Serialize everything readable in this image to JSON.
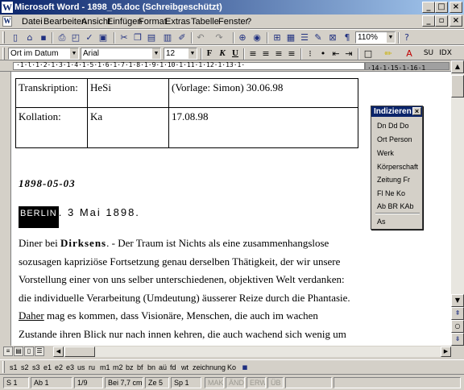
{
  "window": {
    "title": "Microsoft Word - 1898_05.doc (Schreibgeschützt)",
    "app_icon": "W",
    "minimize": "_",
    "maximize": "□",
    "close": "×",
    "doc_minimize": "_",
    "doc_restore": "▫",
    "doc_close": "×"
  },
  "menu": [
    "Datei",
    "Bearbeiten",
    "Ansicht",
    "Einfügen",
    "Format",
    "Extras",
    "Tabelle",
    "Fenster",
    "?"
  ],
  "toolbar": {
    "zoom": "110%",
    "icons": [
      "new-icon",
      "open-icon",
      "save-icon",
      "print-icon",
      "print-preview-icon",
      "spellcheck-icon",
      "research-icon",
      "cut-icon",
      "copy-icon",
      "paste-icon",
      "format-painter-icon",
      "undo-icon",
      "redo-icon",
      "hyperlink-icon",
      "web-icon",
      "table-icon",
      "insert-table-icon",
      "columns-icon",
      "drawing-icon",
      "document-map-icon",
      "show-formatting-icon",
      "help-icon"
    ]
  },
  "formatting": {
    "style": "Ort im Datum",
    "font": "Arial",
    "size": "12",
    "bold": "F",
    "italic": "K",
    "underline": "U",
    "extra1": "SU",
    "extra2": "IDX"
  },
  "document": {
    "table": [
      [
        "Transkription:",
        "HeSi",
        "(Vorlage: Simon) 30.06.98"
      ],
      [
        "Kollation:",
        "Ka",
        "17.08.98"
      ]
    ],
    "date_line": "1898-05-03",
    "place": "Berlin",
    "heading_rest": ". 3 Mai 1898.",
    "paragraph": {
      "l1_pre": "Diner bei ",
      "l1_name": "Dirksens",
      "l1_post": ". - Der Traum ist Nichts als eine zusammenhangslose",
      "l2": "sozusagen kapriziöse Fortsetzung genau derselben Thätigkeit, der wir unsere",
      "l3": "Vorstellung einer von uns selber unterschiedenen, objektiven Welt verdanken:",
      "l4": "die individuelle Verarbeitung (Umdeutung) äusserer Reize durch die Phantasie.",
      "l5_u": "Daher",
      "l5_rest": " mag es kommen, dass Visionäre, Menschen, die auch im wachen",
      "l6": "Zustande ihren Blick nur nach innen kehren, die auch wachend sich wenig um"
    }
  },
  "palette": {
    "title": "Indizieren",
    "rows": [
      "Dn  Dd  Do",
      "Ort  Person",
      "Werk",
      "Körperschaft",
      "Zeitung  Fr",
      "Fl  Ne  Ko",
      "Ab  BR  KAb",
      "As"
    ]
  },
  "style_toolbar": [
    "s1",
    "s2",
    "s3",
    "e1",
    "e2",
    "e3",
    "us",
    "ru",
    "m1",
    "m2",
    "bz",
    "bf",
    "bn",
    "aü",
    "fd",
    "wt",
    "zeichnung",
    "Ko"
  ],
  "status": {
    "section": "S 1",
    "ab": "Ab 1",
    "pages": "1/9",
    "position": "Bei 7,7 cm",
    "line": "Ze 5",
    "column": "Sp 1",
    "modes": [
      "MAK",
      "ÄND",
      "ERW",
      "ÜB"
    ]
  },
  "ruler": {
    "ticks": "·1·l·1·2·1·3·1·4·1·5·1·6·1·7·1·8·1·9·1·10·1·11·1·12·1·13·1·",
    "right_ticks": "·14·1·15·1·16·1"
  }
}
